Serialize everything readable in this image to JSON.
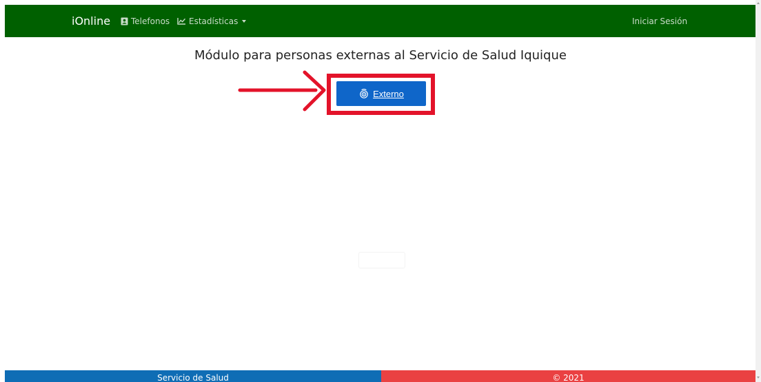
{
  "navbar": {
    "brand": "iOnline",
    "telefonos": {
      "label": "Telefonos",
      "icon": "contact-book-icon"
    },
    "estadisticas": {
      "label": "Estadísticas",
      "icon": "line-chart-icon"
    },
    "login": {
      "label": "Iniciar Sesión"
    },
    "background_color": "#006000"
  },
  "main": {
    "title": "Módulo para personas externas al Servicio de Salud Iquique",
    "externo_button": {
      "label": "Externo",
      "icon": "fingerprint-icon",
      "color": "#0f66c9"
    },
    "annotation": {
      "arrow_color": "#e3132a",
      "highlight_color": "#e3132a"
    }
  },
  "footer": {
    "left_text": "Servicio de Salud",
    "right_text": "© 2021",
    "left_color": "#0f6db5",
    "right_color": "#ea4142"
  }
}
